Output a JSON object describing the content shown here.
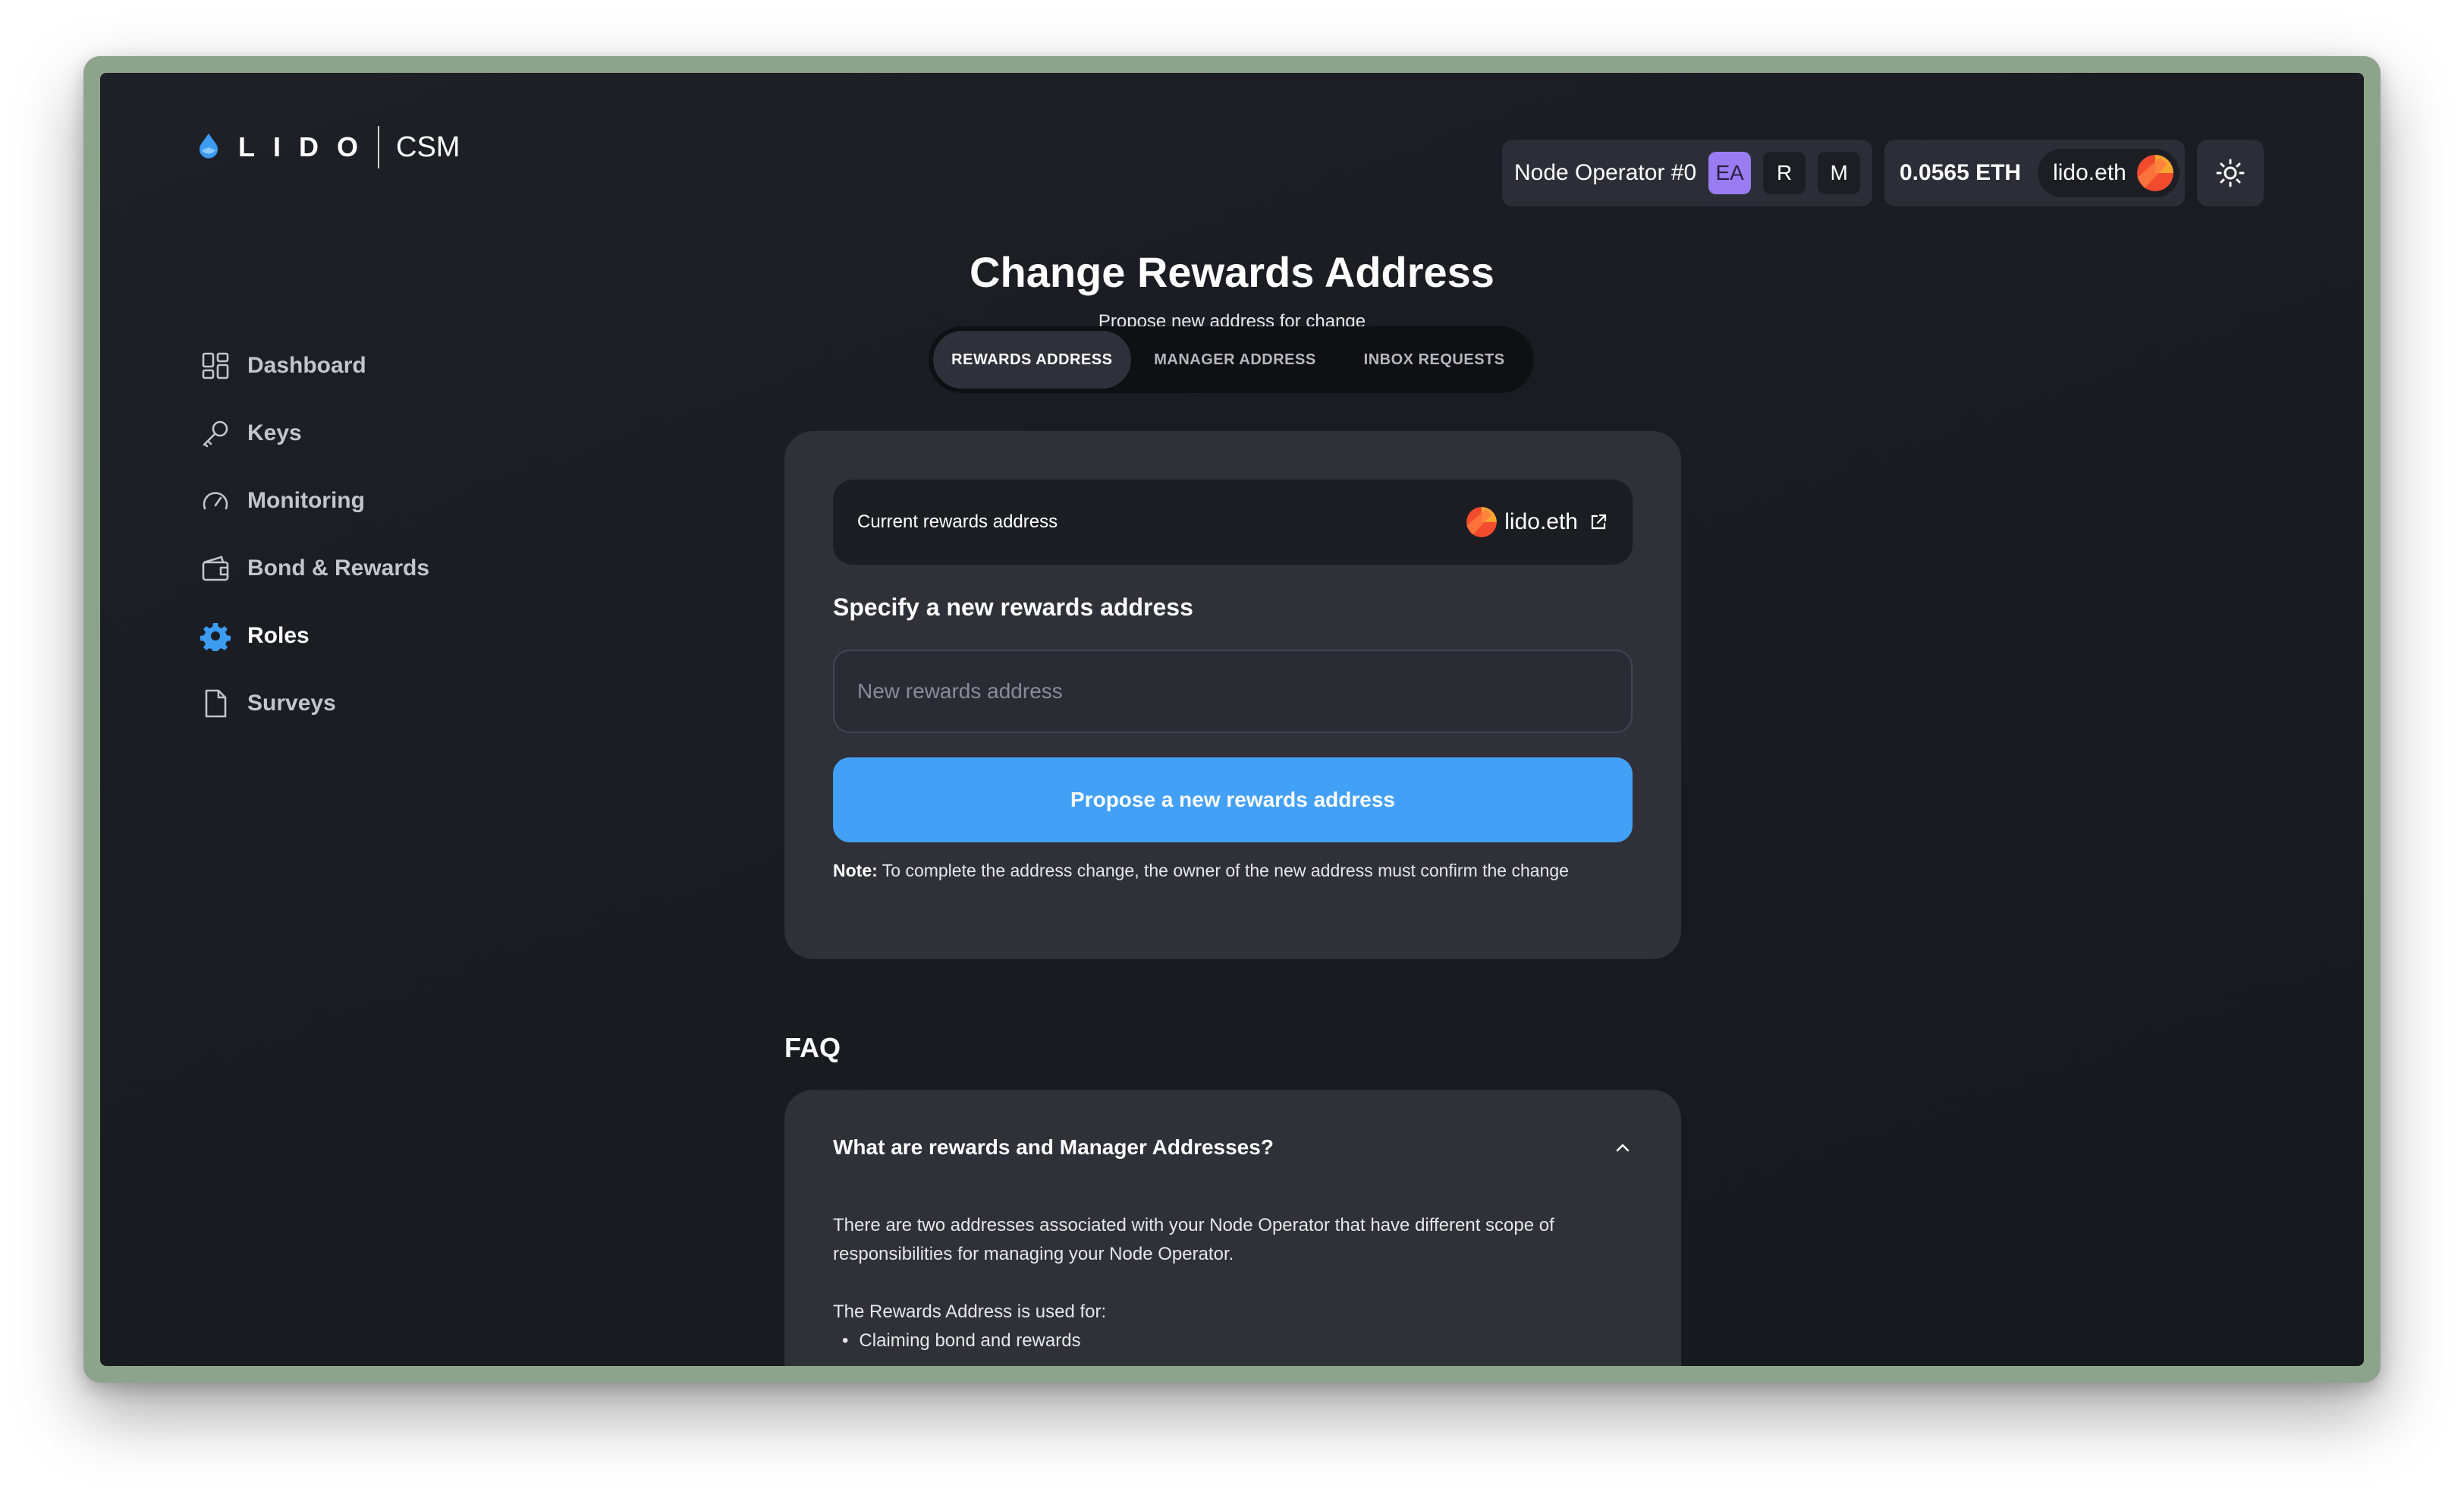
{
  "app": {
    "logo_text": "LIDO",
    "product": "CSM"
  },
  "header": {
    "operator_label": "Node Operator #0",
    "roles": [
      "EA",
      "R",
      "M"
    ],
    "balance": "0.0565 ETH",
    "ens_name": "lido.eth",
    "theme_icon": "sun-icon"
  },
  "sidebar": {
    "items": [
      {
        "label": "Dashboard",
        "icon": "dashboard-icon"
      },
      {
        "label": "Keys",
        "icon": "key-icon"
      },
      {
        "label": "Monitoring",
        "icon": "gauge-icon"
      },
      {
        "label": "Bond & Rewards",
        "icon": "wallet-icon"
      },
      {
        "label": "Roles",
        "icon": "gear-icon",
        "active": true
      },
      {
        "label": "Surveys",
        "icon": "document-icon"
      }
    ]
  },
  "page": {
    "title": "Change Rewards Address",
    "subtitle": "Propose new address for change"
  },
  "tabs": [
    "REWARDS ADDRESS",
    "MANAGER ADDRESS",
    "INBOX REQUESTS"
  ],
  "form": {
    "current_label": "Current rewards address",
    "current_value": "lido.eth",
    "section_heading": "Specify a new rewards address",
    "input_placeholder": "New rewards address",
    "input_value": "",
    "submit_label": "Propose a new rewards address",
    "note_label": "Note:",
    "note_text": " To complete the address change, the owner of the new address must confirm the change"
  },
  "faq": {
    "heading": "FAQ",
    "question": "What are rewards and Manager Addresses?",
    "answer_intro": "There are two addresses associated with your Node Operator that have different scope of responsibilities for managing your Node Operator.",
    "rewards_heading": "The Rewards Address is used for:",
    "rewards_items": [
      "Claiming bond and rewards"
    ]
  },
  "colors": {
    "accent": "#42a0f7",
    "active_role": "#9a7cf2",
    "background": "#1c1e24",
    "card": "#2f3038"
  }
}
